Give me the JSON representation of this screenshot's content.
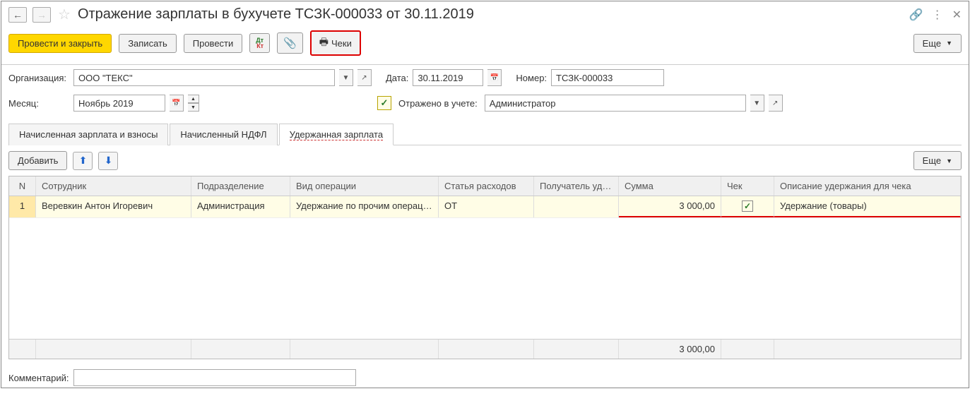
{
  "header": {
    "title": "Отражение зарплаты в бухучете ТСЗК-000033 от 30.11.2019"
  },
  "toolbar": {
    "submit_close": "Провести и закрыть",
    "save": "Записать",
    "submit": "Провести",
    "checks": "Чеки",
    "more": "Еще"
  },
  "form": {
    "org_label": "Организация:",
    "org_value": "ООО \"ТЕКС\"",
    "date_label": "Дата:",
    "date_value": "30.11.2019",
    "number_label": "Номер:",
    "number_value": "ТСЗК-000033",
    "month_label": "Месяц:",
    "month_value": "Ноябрь 2019",
    "reflected_label": "Отражено в учете:",
    "reflected_value": "Администратор"
  },
  "tabs": {
    "t1": "Начисленная зарплата и взносы",
    "t2": "Начисленный НДФЛ",
    "t3": "Удержанная зарплата"
  },
  "tab_toolbar": {
    "add": "Добавить",
    "more": "Еще"
  },
  "table": {
    "headers": {
      "n": "N",
      "employee": "Сотрудник",
      "department": "Подразделение",
      "operation": "Вид операции",
      "expense": "Статья расходов",
      "recipient": "Получатель уде…",
      "sum": "Сумма",
      "check": "Чек",
      "description": "Описание удержания для чека"
    },
    "rows": [
      {
        "n": "1",
        "employee": "Веревкин Антон Игоревич",
        "department": "Администрация",
        "operation": "Удержание по прочим операц…",
        "expense": "ОТ",
        "recipient": "",
        "sum": "3 000,00",
        "check": true,
        "description": "Удержание (товары)"
      }
    ],
    "footer_sum": "3 000,00"
  },
  "comment_label": "Комментарий:"
}
